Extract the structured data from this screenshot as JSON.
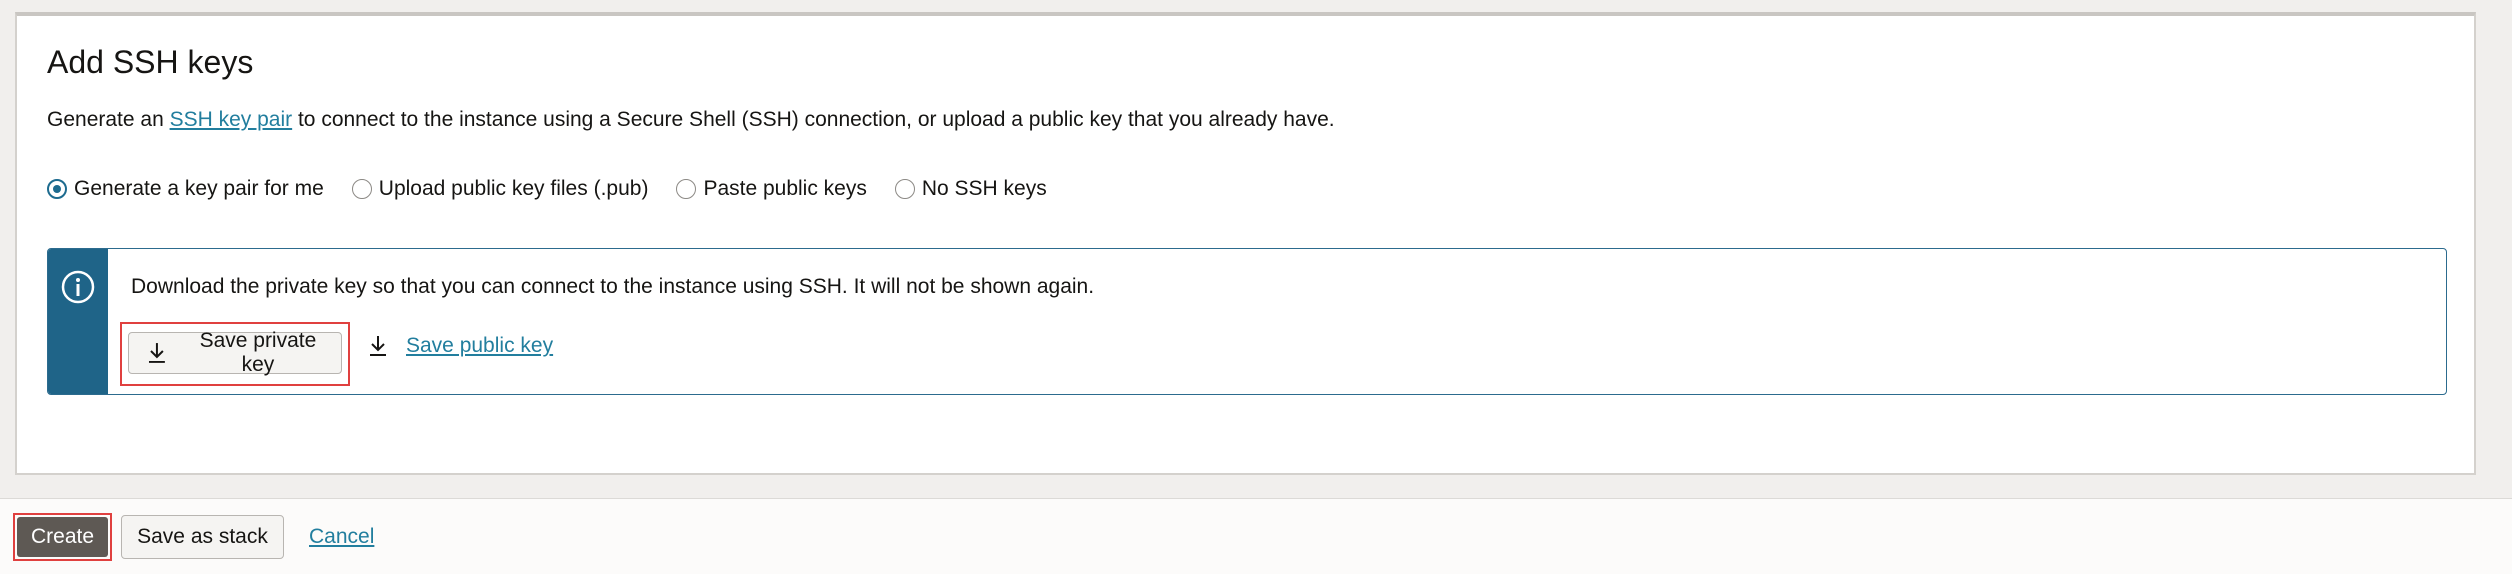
{
  "ssh_section": {
    "title": "Add SSH keys",
    "description_prefix": "Generate an ",
    "description_link": "SSH key pair",
    "description_suffix": " to connect to the instance using a Secure Shell (SSH) connection, or upload a public key that you already have.",
    "options": [
      {
        "label": "Generate a key pair for me",
        "checked": true
      },
      {
        "label": "Upload public key files (.pub)",
        "checked": false
      },
      {
        "label": "Paste public keys",
        "checked": false
      },
      {
        "label": "No SSH keys",
        "checked": false
      }
    ],
    "info_message": "Download the private key so that you can connect to the instance using SSH. It will not be shown again.",
    "save_private_label": "Save private key",
    "save_public_label": "Save public key"
  },
  "footer": {
    "create_label": "Create",
    "save_stack_label": "Save as stack",
    "cancel_label": "Cancel"
  },
  "icons": {
    "info": "info-icon",
    "download": "download-icon"
  },
  "colors": {
    "accent": "#1f6488",
    "link": "#227e9e",
    "highlight": "#e0403f",
    "create_button": "#5e5954"
  }
}
